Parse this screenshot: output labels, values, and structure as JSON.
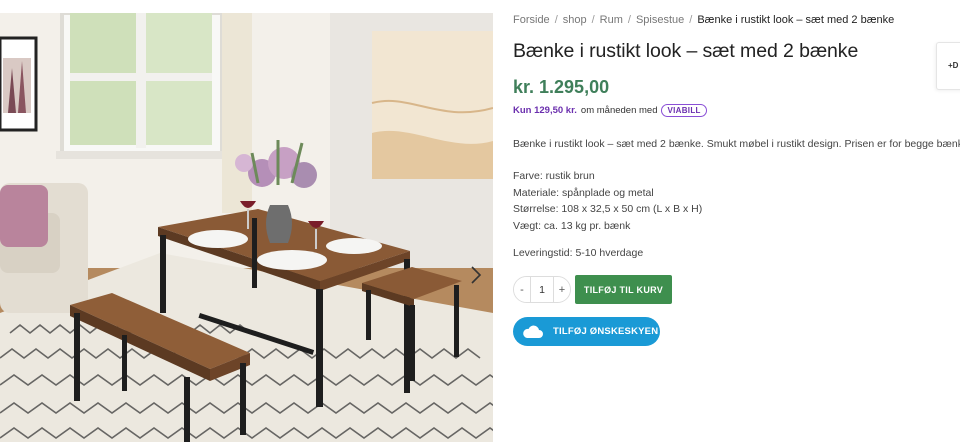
{
  "breadcrumb": {
    "items": [
      "Forside",
      "shop",
      "Rum",
      "Spisestue"
    ],
    "separator": "/",
    "current": "Bænke i rustikt look – sæt med 2 bænke"
  },
  "product": {
    "title": "Bænke i rustikt look – sæt med 2 bænke",
    "price": "kr. 1.295,00",
    "viabill": {
      "amount": "Kun 129,50 kr.",
      "text": "om måneden med",
      "badge": "VIABILL"
    },
    "description": "Bænke i rustikt look – sæt med 2 bænke.  Smukt møbel i rustikt design. Prisen er for begge bænke.",
    "specs": [
      "Farve: rustik brun",
      "Materiale: spånplade og metal",
      "Størrelse: 108 x 32,5 x 50 cm (L x B x H)",
      "Vægt: ca. 13 kg pr. bænk"
    ],
    "delivery": "Leveringstid: 5-10 hverdage"
  },
  "cart": {
    "minus": "-",
    "quantity": "1",
    "plus": "+",
    "add_label": "TILFØJ TIL KURV"
  },
  "wishlist": {
    "label": "TILFØJ ØNSKESKYEN",
    "icon": "cloud-icon"
  },
  "side_tab": {
    "glyph": "+D"
  },
  "gallery": {
    "next_icon": "chevron-right-icon"
  },
  "colors": {
    "price": "#3f7f5a",
    "add_to_cart": "#3e8f4e",
    "wishlist": "#1a9ad6",
    "viabill": "#6b2fae"
  }
}
